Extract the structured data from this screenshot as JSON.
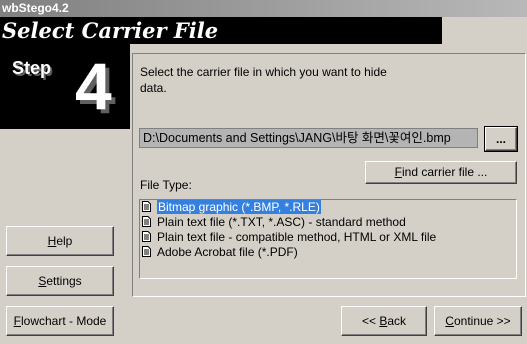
{
  "window": {
    "title": "wbStego4.2"
  },
  "header": {
    "title": "Select Carrier File",
    "step_word": "Step",
    "step_number": "4"
  },
  "main": {
    "instruction": "Select the carrier file in which you want to hide data.",
    "path_value": "D:\\Documents and Settings\\JANG\\바탕 화면\\꽃여인.bmp",
    "browse_label": "...",
    "find_button": {
      "pre": "",
      "hot": "F",
      "post": "ind carrier file ..."
    },
    "file_type_label": "File Type:",
    "file_types": [
      "Bitmap graphic (*.BMP, *.RLE)",
      "Plain text file (*.TXT, *.ASC) - standard method",
      "Plain text file - compatible method, HTML or XML file",
      "Adobe Acrobat file (*.PDF)"
    ],
    "selected_index": 0
  },
  "sidebar": {
    "help": {
      "pre": "",
      "hot": "H",
      "post": "elp"
    },
    "settings": {
      "pre": "",
      "hot": "S",
      "post": "ettings"
    },
    "flowchart": {
      "pre": "",
      "hot": "F",
      "post": "lowchart - Mode"
    }
  },
  "footer": {
    "back": {
      "pre": "<< ",
      "hot": "B",
      "post": "ack"
    },
    "continue": {
      "pre": "",
      "hot": "C",
      "post": "ontinue >>"
    }
  },
  "colors": {
    "selection": "#3380e0",
    "background": "#d4d0c8"
  },
  "icons": {
    "file_type_item": "document-icon"
  }
}
